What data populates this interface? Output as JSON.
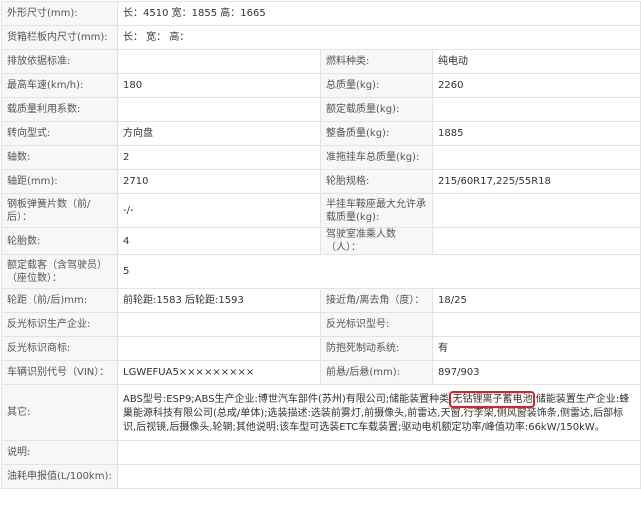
{
  "rows": [
    {
      "l1": "外形尺寸(mm):",
      "v1": "长：4510 宽：1855 高：1665"
    },
    {
      "l1": "货箱栏板内尺寸(mm):",
      "v1": "长： 宽： 高："
    },
    {
      "l1": "排放依据标准:",
      "v1": "",
      "l2": "燃料种类:",
      "v2": "纯电动"
    },
    {
      "l1": "最高车速(km/h):",
      "v1": "180",
      "l2": "总质量(kg):",
      "v2": "2260"
    },
    {
      "l1": "载质量利用系数:",
      "v1": "",
      "l2": "额定载质量(kg):",
      "v2": ""
    },
    {
      "l1": "转向型式:",
      "v1": "方向盘",
      "l2": "整备质量(kg):",
      "v2": "1885"
    },
    {
      "l1": "轴数:",
      "v1": "2",
      "l2": "准拖挂车总质量(kg):",
      "v2": ""
    },
    {
      "l1": "轴距(mm):",
      "v1": "2710",
      "l2": "轮胎规格:",
      "v2": "215/60R17,225/55R18"
    },
    {
      "l1": "钢板弹簧片数（前/后）：",
      "v1": "-/-",
      "l2": "半挂车鞍座最大允许承载质量(kg):",
      "v2": ""
    },
    {
      "l1": "轮胎数:",
      "v1": "4",
      "l2": "驾驶室准乘人数（人）：",
      "v2": ""
    },
    {
      "l1": "额定载客（含驾驶员）（座位数）：",
      "v1": "5"
    },
    {
      "l1": "轮距（前/后)mm:",
      "v1": "前轮距:1583 后轮距:1593",
      "l2": "接近角/离去角（度）：",
      "v2": "18/25"
    },
    {
      "l1": "反光标识生产企业:",
      "v1": "",
      "l2": "反光标识型号:",
      "v2": ""
    },
    {
      "l1": "反光标识商标:",
      "v1": "",
      "l2": "防抱死制动系统:",
      "v2": "有"
    },
    {
      "l1": "车辆识别代号（VIN）：",
      "v1": "LGWEFUA5×××××××××",
      "l2": "前悬/后悬(mm):",
      "v2": "897/903"
    }
  ],
  "other": {
    "label": "其它:",
    "before": "ABS型号:ESP9;ABS生产企业:博世汽车部件(苏州)有限公司;储能装置种类:",
    "highlight": "无钴锂离子蓄电池",
    "after": ";储能装置生产企业:蜂巢能源科技有限公司(总成/单体);选装描述:选装前雾灯,前摄像头,前雷达,天窗,行李架,侧风窗装饰条,侧雷达,后部标识,后视镜,后摄像头,轮辋;其他说明:该车型可选装ETC车载装置;驱动电机额定功率/峰值功率:66kW/150kW。"
  },
  "footer": [
    {
      "l1": "说明:",
      "v1": ""
    },
    {
      "l1": "油耗申报值(L/100km):",
      "v1": ""
    }
  ],
  "colors": {
    "highlight_border": "#e02020",
    "label_bg": "#f7f7f7",
    "border": "#e3e3e3"
  }
}
